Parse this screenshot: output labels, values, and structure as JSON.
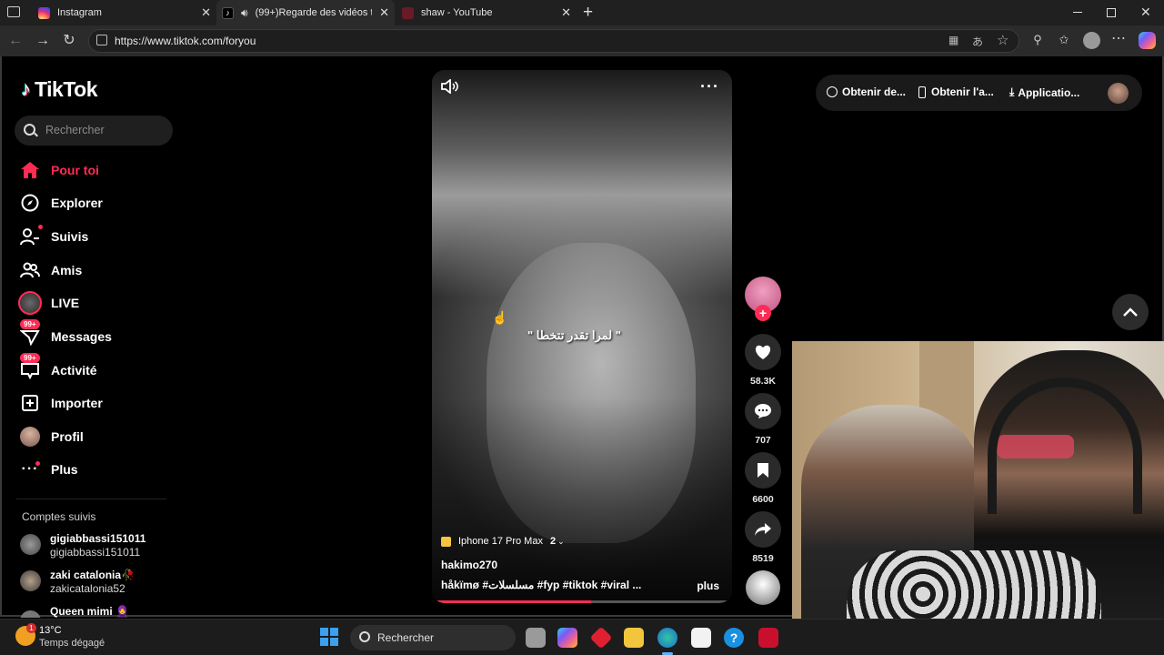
{
  "browser": {
    "tabs": [
      {
        "label": "Instagram",
        "icon": "instagram-icon"
      },
      {
        "label": "(99+)Regarde des vidéos ter",
        "icon": "tiktok-icon"
      },
      {
        "label": "shaw - YouTube",
        "icon": "youtube-icon"
      }
    ],
    "new_tab_symbol": "+",
    "url": "https://www.tiktok.com/foryou"
  },
  "tiktok": {
    "logo_text": "TikTok",
    "search_placeholder": "Rechercher",
    "nav": [
      {
        "label": "Pour toi",
        "icon": "home-icon",
        "active": true
      },
      {
        "label": "Explorer",
        "icon": "compass-icon"
      },
      {
        "label": "Suivis",
        "icon": "following-icon"
      },
      {
        "label": "Amis",
        "icon": "friends-icon"
      },
      {
        "label": "LIVE",
        "icon": "live-icon"
      },
      {
        "label": "Messages",
        "icon": "messages-icon",
        "badge": "99+"
      },
      {
        "label": "Activité",
        "icon": "activity-icon",
        "badge": "99+"
      },
      {
        "label": "Importer",
        "icon": "upload-icon"
      },
      {
        "label": "Profil",
        "icon": "profile-avatar-icon"
      },
      {
        "label": "Plus",
        "icon": "more-icon"
      }
    ],
    "followed_title": "Comptes suivis",
    "followed": [
      {
        "name": "gigiabbassi151011",
        "handle": "gigiabbassi151011"
      },
      {
        "name": "zaki catalonia🥀",
        "handle": "zakicatalonia52"
      },
      {
        "name": "Queen mimi 🧕",
        "handle": ""
      }
    ],
    "video": {
      "overlay_text": "\" لمرا تقدر تتخطا \"",
      "product_tag": "Iphone 17 Pro Max",
      "product_count": "2",
      "author": "hakimo270",
      "description": "håkïmø #مسلسلات #fyp #tiktok #viral ...",
      "more_label": "plus",
      "progress": 0.53
    },
    "actions": {
      "likes": "58.3K",
      "comments": "707",
      "saves": "6600",
      "shares": "8519"
    },
    "top_right": {
      "coins": "Obtenir de...",
      "app": "Obtenir l'a...",
      "install": "Applicatio..."
    }
  },
  "taskbar": {
    "temperature": "13°C",
    "weather": "Temps dégagé",
    "weather_badge": "1",
    "search_placeholder": "Rechercher"
  },
  "colors": {
    "accent": "#fe2c55",
    "page_bg": "#000000",
    "chrome_bg": "#202020"
  }
}
